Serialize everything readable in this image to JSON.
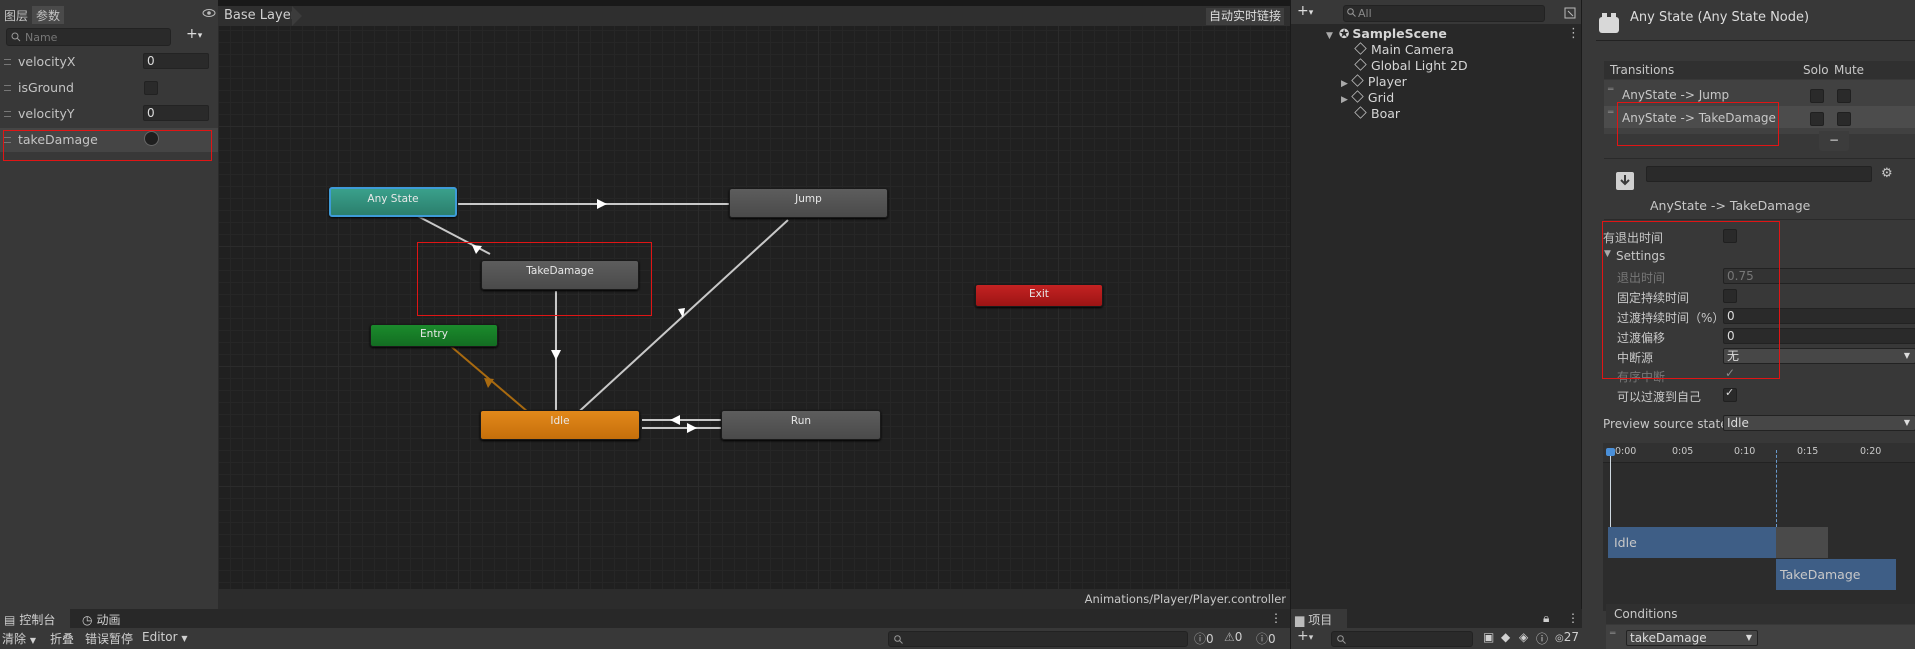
{
  "params": {
    "tabs": [
      "图层",
      "参数"
    ],
    "search_placeholder": "Name",
    "items": [
      {
        "name": "velocityX",
        "type": "float",
        "value": "0"
      },
      {
        "name": "isGround",
        "type": "bool",
        "value": ""
      },
      {
        "name": "velocityY",
        "type": "float",
        "value": "0"
      },
      {
        "name": "takeDamage",
        "type": "trigger",
        "value": ""
      }
    ]
  },
  "graph": {
    "breadcrumb": "Base Layer",
    "live_link": "自动实时链接",
    "path": "Animations/Player/Player.controller",
    "nodes": {
      "any_state": "Any State",
      "jump": "Jump",
      "take_damage": "TakeDamage",
      "exit": "Exit",
      "entry": "Entry",
      "idle": "Idle",
      "run": "Run"
    }
  },
  "hierarchy": {
    "search_placeholder": "All",
    "scene": "SampleScene",
    "items": [
      "Main Camera",
      "Global Light 2D",
      "Player",
      "Grid",
      "Boar"
    ]
  },
  "inspector": {
    "title": "Any State (Any State Node)",
    "transitions_header": "Transitions",
    "solo": "Solo",
    "mute": "Mute",
    "transitions": [
      "AnyState -> Jump",
      "AnyState -> TakeDamage"
    ],
    "minus": "−",
    "selected_transition": "AnyState -> TakeDamage",
    "has_exit_time": "有退出时间",
    "settings": "Settings",
    "exit_time_label": "退出时间",
    "exit_time_value": "0.75",
    "fixed_duration": "固定持续时间",
    "transition_duration": "过渡持续时间（%）",
    "transition_duration_value": "0",
    "transition_offset": "过渡偏移",
    "transition_offset_value": "0",
    "interruption_source": "中断源",
    "interruption_source_value": "无",
    "ordered_interruption": "有序中断",
    "can_transition_to_self": "可以过渡到自己",
    "preview_label": "Preview source state",
    "preview_value": "Idle",
    "timeline_ticks": [
      "0:00",
      "0:05",
      "0:10",
      "0:15",
      "0:20"
    ],
    "timeline_idle": "Idle",
    "timeline_takedamage": "TakeDamage",
    "conditions": "Conditions",
    "condition_param": "takeDamage"
  },
  "console": {
    "tabs": [
      "控制台",
      "动画"
    ],
    "clear": "清除",
    "collapse": "折叠",
    "error_pause": "错误暂停",
    "editor": "Editor",
    "counts": [
      "0",
      "0",
      "0"
    ]
  },
  "project": {
    "tab": "项目",
    "count": "27"
  }
}
